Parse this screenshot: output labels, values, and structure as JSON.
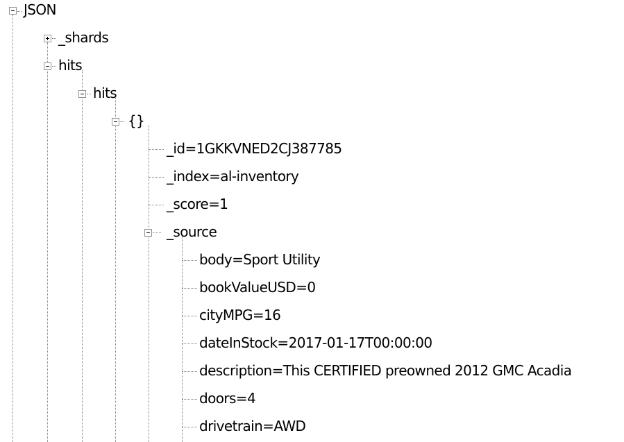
{
  "tree": {
    "root": {
      "label": "JSON",
      "state": "expanded"
    },
    "shards": {
      "label": "_shards",
      "state": "collapsed"
    },
    "hits_outer": {
      "label": "hits",
      "state": "expanded"
    },
    "hits_inner": {
      "label": "hits",
      "state": "expanded"
    },
    "object": {
      "label": "{}",
      "state": "expanded"
    },
    "id": {
      "label": "_id=1GKKVNED2CJ387785"
    },
    "index": {
      "label": "_index=al-inventory"
    },
    "score": {
      "label": "_score=1"
    },
    "source": {
      "label": "_source",
      "state": "expanded"
    },
    "source_fields": [
      {
        "label": "body=Sport Utility"
      },
      {
        "label": "bookValueUSD=0"
      },
      {
        "label": "cityMPG=16"
      },
      {
        "label": "dateInStock=2017-01-17T00:00:00"
      },
      {
        "label": "description=This CERTIFIED preowned 2012 GMC Acadia"
      },
      {
        "label": "doors=4"
      },
      {
        "label": "drivetrain=AWD"
      }
    ]
  },
  "icons": {
    "expanded": "minus-box-icon",
    "collapsed": "plus-box-icon"
  },
  "colors": {
    "background": "#ffffff",
    "text": "#000000",
    "connector": "#808080",
    "toggle_border": "#919191"
  }
}
